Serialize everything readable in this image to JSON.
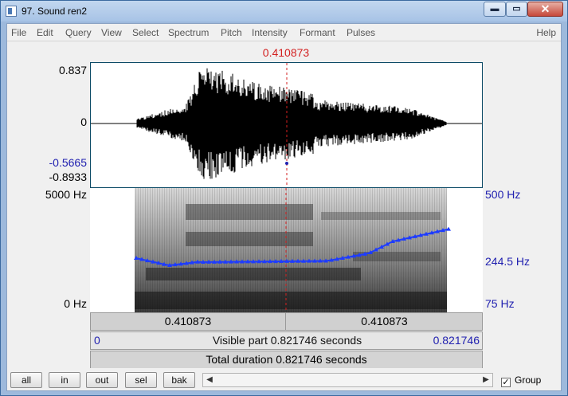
{
  "window": {
    "title": "97. Sound ren2",
    "controls": {
      "minimize": "▬",
      "maximize": "▭",
      "close": "✕"
    }
  },
  "menu": {
    "items": [
      "File",
      "Edit",
      "Query",
      "View",
      "Select",
      "Spectrum",
      "Pitch",
      "Intensity",
      "Formant",
      "Pulses"
    ],
    "help": "Help"
  },
  "cursor": {
    "time": "0.410873",
    "color": "#d32020"
  },
  "waveform": {
    "max": "0.837",
    "zero": "0",
    "cursor_value": "-0.5665",
    "min": "-0.8933"
  },
  "spectrogram": {
    "freq_max": "5000 Hz",
    "freq_min": "0 Hz",
    "pitch_max": "500 Hz",
    "pitch_at_cursor": "244.5 Hz",
    "pitch_min": "75 Hz"
  },
  "tiers": {
    "row1": {
      "left": "0.410873",
      "right": "0.410873"
    },
    "row2": {
      "start": "0",
      "label": "Visible part 0.821746 seconds",
      "end": "0.821746"
    },
    "row3": {
      "label": "Total duration 0.821746 seconds"
    }
  },
  "buttons": {
    "all": "all",
    "in": "in",
    "out": "out",
    "sel": "sel",
    "bak": "bak"
  },
  "scroll": {
    "left_arrow": "◀",
    "right_arrow": "▶"
  },
  "group": {
    "label": "Group",
    "checked": true
  },
  "colors": {
    "accent_blue": "#2020b0",
    "cursor_red": "#d32020",
    "pitch_curve": "#1e3cff"
  }
}
